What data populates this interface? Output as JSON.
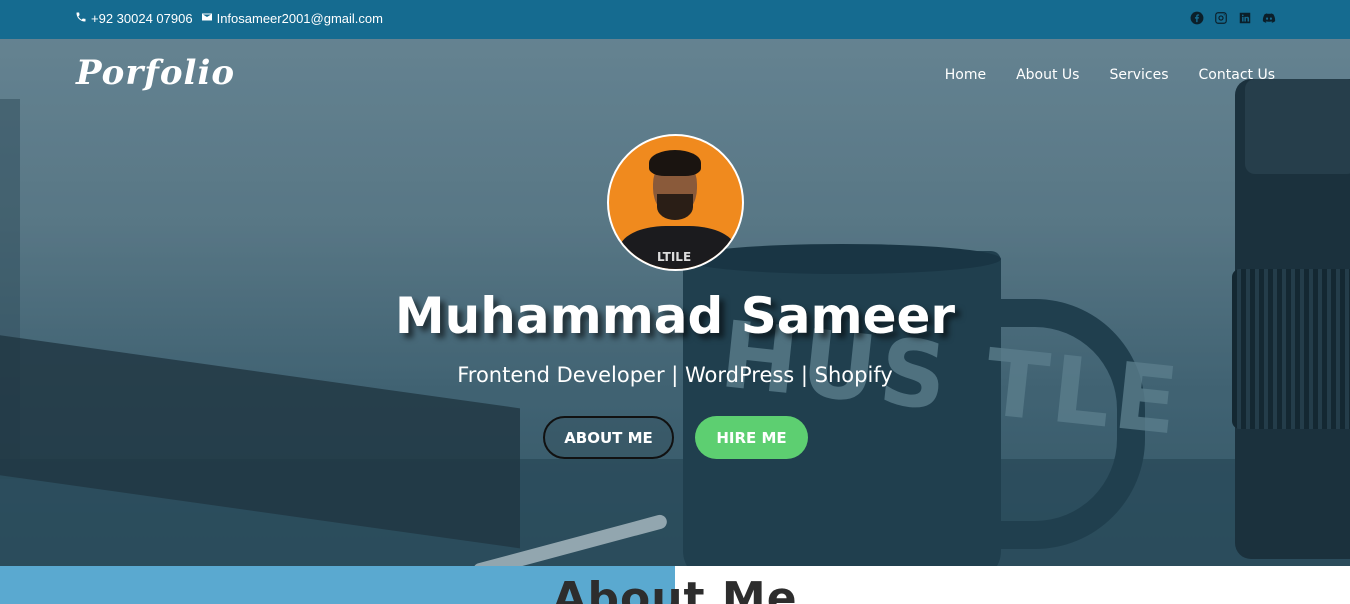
{
  "topbar": {
    "phone": "+92 30024 07906",
    "email": "Infosameer2001@gmail.com",
    "socials": [
      "facebook-icon",
      "instagram-icon",
      "linkedin-icon",
      "discord-icon"
    ]
  },
  "header": {
    "logo": "Porfolio",
    "nav": [
      "Home",
      "About Us",
      "Services",
      "Contact Us"
    ]
  },
  "hero": {
    "name": "Muhammad Sameer",
    "tagline": "Frontend Developer | WordPress | Shopify",
    "about_button": "ABOUT ME",
    "hire_button": "HIRE ME",
    "mug_text": "HUS TLE",
    "avatar_shirt_text": "LTILE"
  },
  "about": {
    "title": "About Me"
  },
  "colors": {
    "topbar": "#156b90",
    "hire_button": "#5dcf71",
    "about_bar": "#5aa9d0",
    "avatar_bg": "#f08a1e"
  }
}
